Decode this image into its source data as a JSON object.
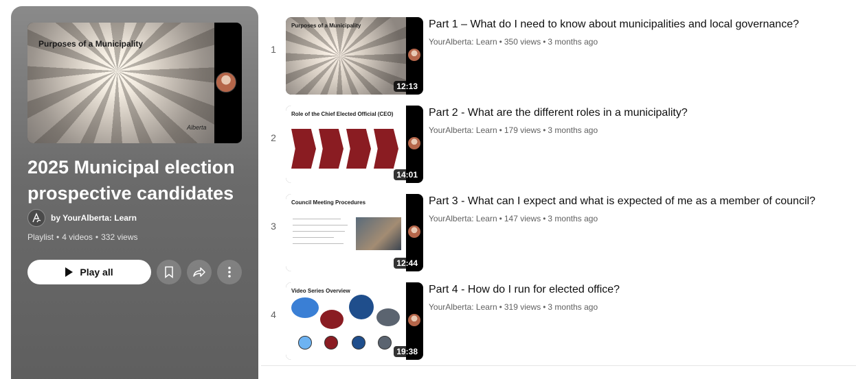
{
  "playlist": {
    "thumbnail_slide_title": "Purposes of a Municipality",
    "title": "2025 Municipal election prospective candidates",
    "owner": "by YourAlberta: Learn",
    "type": "Playlist",
    "video_count": "4 videos",
    "views": "332 views",
    "play_all_label": "Play all",
    "icons": {
      "save": "bookmark-icon",
      "share": "share-icon",
      "more": "more-vert-icon",
      "play": "play-icon"
    }
  },
  "videos": [
    {
      "index": "1",
      "title": "Part 1 – What do I need to know about municipalities and local governance?",
      "channel": "YourAlberta: Learn",
      "views": "350 views",
      "age": "3 months ago",
      "duration": "12:13",
      "slide_title": "Purposes of a Municipality"
    },
    {
      "index": "2",
      "title": "Part 2 - What are the different roles in a municipality?",
      "channel": "YourAlberta: Learn",
      "views": "179 views",
      "age": "3 months ago",
      "duration": "14:01",
      "slide_title": "Role of the Chief Elected Official (CEO)"
    },
    {
      "index": "3",
      "title": "Part 3 - What can I expect and what is expected of me as a member of council?",
      "channel": "YourAlberta: Learn",
      "views": "147 views",
      "age": "3 months ago",
      "duration": "12:44",
      "slide_title": "Council Meeting Procedures"
    },
    {
      "index": "4",
      "title": "Part 4 - How do I run for elected office?",
      "channel": "YourAlberta: Learn",
      "views": "319 views",
      "age": "3 months ago",
      "duration": "19:38",
      "slide_title": "Video Series Overview"
    }
  ],
  "colors": {
    "panel": "#6b6b6b",
    "slide_accent": "#8a1c22",
    "text_secondary": "#606060"
  }
}
